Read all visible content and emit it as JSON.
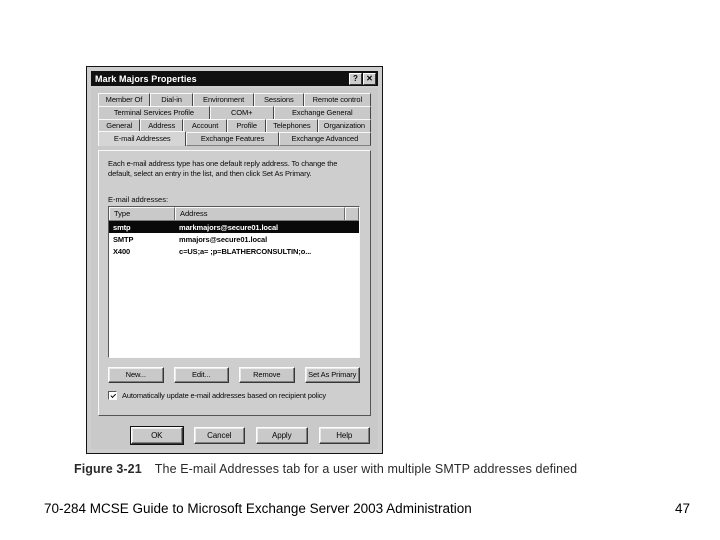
{
  "dialog": {
    "title": "Mark Majors Properties",
    "system_buttons": [
      {
        "name": "help-button",
        "glyph": "?"
      },
      {
        "name": "close-button",
        "glyph": "✕"
      }
    ],
    "tab_rows": [
      [
        "Member Of",
        "Dial-in",
        "Environment",
        "Sessions",
        "Remote control"
      ],
      [
        "Terminal Services Profile",
        "COM+",
        "Exchange General"
      ],
      [
        "General",
        "Address",
        "Account",
        "Profile",
        "Telephones",
        "Organization"
      ],
      [
        "E-mail Addresses",
        "Exchange Features",
        "Exchange Advanced"
      ]
    ],
    "active_tab": "E-mail Addresses",
    "description": "Each e-mail address type has one default reply address. To change the default, select an entry in the list, and then click Set As Primary.",
    "addresses_label": "E-mail addresses:",
    "list": {
      "columns": [
        "Type",
        "Address"
      ],
      "rows": [
        {
          "type": "smtp",
          "address": "markmajors@secure01.local",
          "selected": true
        },
        {
          "type": "SMTP",
          "address": "mmajors@secure01.local",
          "selected": false
        },
        {
          "type": "X400",
          "address": "c=US;a= ;p=BLATHERCONSULTIN;o...",
          "selected": false
        }
      ]
    },
    "action_buttons": [
      "New...",
      "Edit...",
      "Remove",
      "Set As Primary"
    ],
    "checkbox": {
      "label": "Automatically update e-mail addresses based on recipient policy",
      "checked": true
    },
    "footer_buttons": [
      "OK",
      "Cancel",
      "Apply",
      "Help"
    ]
  },
  "caption": {
    "number": "Figure 3-21",
    "text": "The E-mail Addresses tab for a user with multiple SMTP addresses defined"
  },
  "page_footer": {
    "text": "70-284 MCSE Guide to Microsoft Exchange Server 2003 Administration",
    "page_number": "47"
  },
  "colors": {
    "dialog_face": "#c4c4c4",
    "titlebar": "#181818",
    "selection": "#121212",
    "listview_bg": "#ffffff"
  }
}
